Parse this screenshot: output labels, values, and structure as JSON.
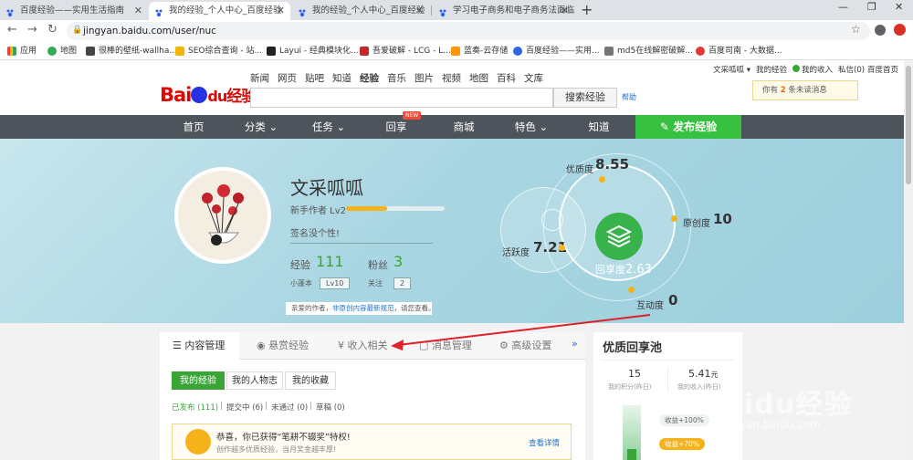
{
  "browser": {
    "tabs": [
      {
        "title": "百度经验——实用生活指南",
        "active": false
      },
      {
        "title": "我的经验_个人中心_百度经验",
        "active": true
      },
      {
        "title": "我的经验_个人中心_百度经验",
        "active": false
      },
      {
        "title": "学习电子商务和电子商务法面临...",
        "active": false
      }
    ],
    "url": "jingyan.baidu.com/user/nuc",
    "bookmarks": [
      "应用",
      "地图",
      "很棒的壁纸-wallha...",
      "SEO综合查询 - 站...",
      "Layui - 经典模块化...",
      "吾爱破解 - LCG - L...",
      "蓝奏-云存储",
      "百度经验——实用...",
      "md5在线解密破解...",
      "百度司南 - 大数据..."
    ]
  },
  "header": {
    "topnav": [
      "新闻",
      "网页",
      "贴吧",
      "知道",
      "经验",
      "音乐",
      "图片",
      "视频",
      "地图",
      "百科",
      "文库"
    ],
    "logo_bai": "Bai",
    "logo_du": "du",
    "logo_jy": "经验",
    "search_button": "搜索经验",
    "help": "帮助",
    "user_name": "文采呱呱",
    "links": [
      "我的经验",
      "我的收入",
      "私信(0)",
      "百度首页"
    ],
    "notice_pre": "你有",
    "notice_count": "2",
    "notice_post": "条未读消息"
  },
  "mainnav": {
    "items": [
      "首页",
      "分类",
      "任务",
      "回享",
      "商城",
      "特色",
      "知道"
    ],
    "new_badge": "NEW",
    "publish": "发布经验"
  },
  "profile": {
    "name": "文采呱呱",
    "level": "新手作者 Lv2",
    "level_progress": 0.42,
    "signature": "签名没个性!",
    "exp_label": "经验",
    "exp_value": "111",
    "fans_label": "粉丝",
    "fans_value": "3",
    "rank_label": "小蓬本",
    "rank_value": "Lv10",
    "follow_label": "关注",
    "follow_value": "2",
    "tip_pre": "亲爱的作者，",
    "tip_link": "非原创内容最新规范",
    "tip_post": "，请您查看。"
  },
  "metrics": {
    "quality_label": "优质度",
    "quality_value": "8.55",
    "original_label": "原创度",
    "original_value": "10",
    "activity_label": "活跃度",
    "activity_value": "7.21",
    "share_label": "回享度",
    "share_value": "2.63",
    "interact_label": "互动度",
    "interact_value": "0"
  },
  "content": {
    "tabs": [
      "内容管理",
      "悬赏经验",
      "收入相关",
      "消息管理",
      "高级设置"
    ],
    "more": "»",
    "subtabs": [
      "我的经验",
      "我的人物志",
      "我的收藏"
    ],
    "filters": [
      {
        "label": "已发布 (111)",
        "active": true
      },
      {
        "label": "提交中 (6)",
        "active": false
      },
      {
        "label": "未通过 (0)",
        "active": false
      },
      {
        "label": "草稿 (0)",
        "active": false
      }
    ],
    "congrats_title": "恭喜，你已获得“笔耕不辍奖”特权!",
    "congrats_sub": "创作越多优质经验，当月奖金越丰厚!",
    "congrats_link": "查看详情"
  },
  "pool": {
    "title": "优质回享池",
    "points_value": "15",
    "points_label": "我的积分(昨日)",
    "income_value": "5.41",
    "income_unit": "元",
    "income_label": "我的收入(昨日)",
    "bubble1": "收益+100%",
    "bubble2": "收益+70%"
  },
  "watermark": {
    "site": "jingyan.baidu.com"
  },
  "colors": {
    "accent_green": "#38c141",
    "nav_dark": "#4e545b",
    "baidu_red": "#e10602",
    "baidu_blue": "#2932e1"
  }
}
